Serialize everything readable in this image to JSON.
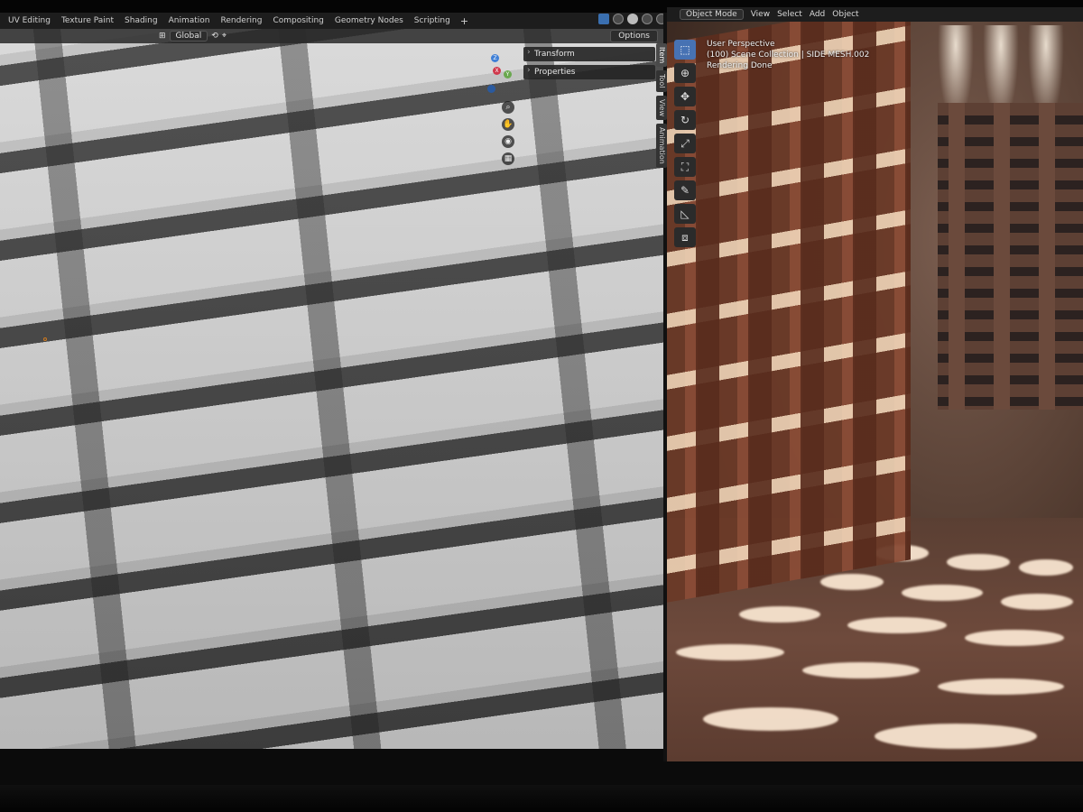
{
  "workspace_tabs": [
    "UV Editing",
    "Texture Paint",
    "Shading",
    "Animation",
    "Rendering",
    "Compositing",
    "Geometry Nodes",
    "Scripting"
  ],
  "workspace_add": "+",
  "left_viewport": {
    "orientation": "Global",
    "options_label": "Options",
    "npanel": {
      "transform": "Transform",
      "properties": "Properties"
    },
    "side_tabs": [
      "Item",
      "Tool",
      "View",
      "Animation"
    ],
    "gizmo": {
      "x": "X",
      "y": "Y",
      "z": "Z"
    },
    "nav_icons": [
      "zoom-icon",
      "hand-pan-icon",
      "camera-icon",
      "grid-icon"
    ]
  },
  "right_viewport": {
    "header": {
      "mode": "Object Mode",
      "menu": [
        "View",
        "Select",
        "Add",
        "Object"
      ]
    },
    "overlay": {
      "line1": "User Perspective",
      "line2": "(100) Scene Collection | SIDE MESH.002",
      "line3": "Rendering Done"
    },
    "tools": [
      "select-box-icon",
      "cursor-icon",
      "move-icon",
      "rotate-icon",
      "scale-icon",
      "transform-icon",
      "annotate-icon",
      "measure-icon",
      "add-cube-icon"
    ]
  },
  "colors": {
    "accent": "#4772b3",
    "header_bg": "#1d1d1d",
    "gizmo_x": "#d0384b",
    "gizmo_y": "#6aa84f",
    "gizmo_z": "#3f7fd6"
  }
}
